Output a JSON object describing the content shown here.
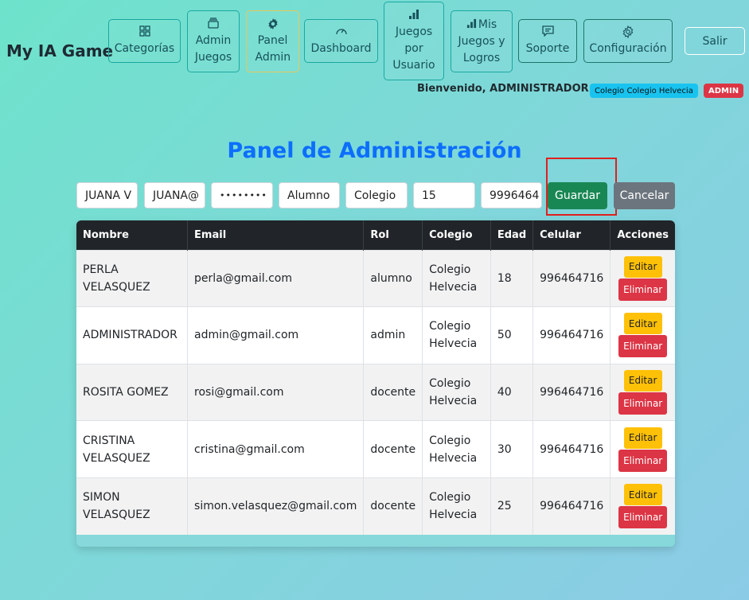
{
  "header": {
    "brand": "My IA Game",
    "nav": [
      {
        "label": "Categorías",
        "icon": "grid-icon"
      },
      {
        "label": "Admin Juegos",
        "icon": "stack-icon"
      },
      {
        "label": "Panel Admin",
        "icon": "gear-icon"
      },
      {
        "label": "Dashboard",
        "icon": "speedometer-icon"
      },
      {
        "label": "Juegos por Usuario",
        "icon": "bar-chart-icon"
      },
      {
        "label": "Mis Juegos y Logros",
        "icon": "bar-chart-icon"
      },
      {
        "label": "Soporte",
        "icon": "chat-icon"
      },
      {
        "label": "Configuración",
        "icon": "gear-outline-icon"
      }
    ],
    "logout_label": "Salir",
    "welcome": "Bienvenido, ADMINISTRADOR",
    "school_badge": "Colegio Colegio Helvecia",
    "role_badge": "ADMIN"
  },
  "main": {
    "title": "Panel de Administración",
    "form": {
      "name": "JUANA V",
      "email": "JUANA@",
      "password": "••••••••",
      "role": "Alumno",
      "school": "Colegio",
      "age": "15",
      "phone": "9996464",
      "save_label": "Guardar",
      "cancel_label": "Cancelar"
    },
    "table": {
      "columns": [
        "Nombre",
        "Email",
        "Rol",
        "Colegio",
        "Edad",
        "Celular",
        "Acciones"
      ],
      "edit_label": "Editar",
      "delete_label": "Eliminar",
      "rows": [
        {
          "name": "PERLA VELASQUEZ",
          "email": "perla@gmail.com",
          "role": "alumno",
          "school": "Colegio Helvecia",
          "age": "18",
          "phone": "996464716"
        },
        {
          "name": "ADMINISTRADOR",
          "email": "admin@gmail.com",
          "role": "admin",
          "school": "Colegio Helvecia",
          "age": "50",
          "phone": "996464716"
        },
        {
          "name": "ROSITA GOMEZ",
          "email": "rosi@gmail.com",
          "role": "docente",
          "school": "Colegio Helvecia",
          "age": "40",
          "phone": "996464716"
        },
        {
          "name": "CRISTINA VELASQUEZ",
          "email": "cristina@gmail.com",
          "role": "docente",
          "school": "Colegio Helvecia",
          "age": "30",
          "phone": "996464716"
        },
        {
          "name": "SIMON VELASQUEZ",
          "email": "simon.velasquez@gmail.com",
          "role": "docente",
          "school": "Colegio Helvecia",
          "age": "25",
          "phone": "996464716"
        }
      ]
    }
  },
  "colors": {
    "accent": "#0d6efd",
    "save": "#198754",
    "cancel": "#6c757d",
    "edit": "#ffc107",
    "delete": "#dc3545",
    "highlight": "#e0201e"
  }
}
